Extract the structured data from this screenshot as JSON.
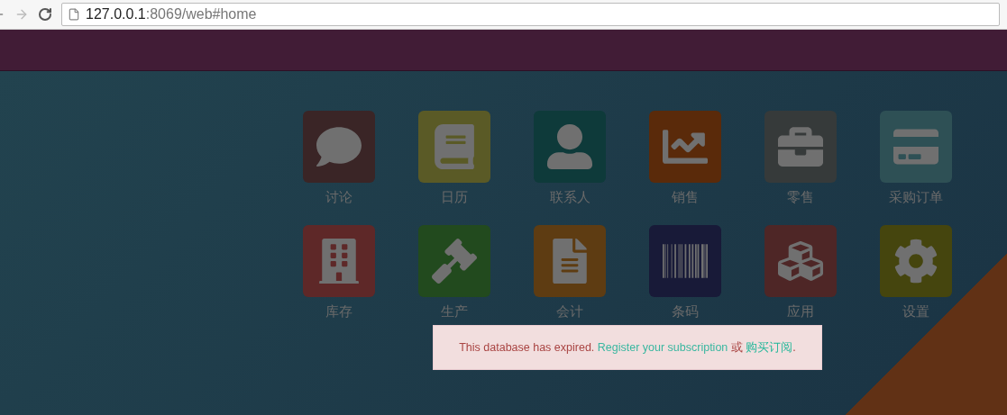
{
  "browser": {
    "url_host": "127.0.0.1",
    "url_path": ":8069/web#home"
  },
  "apps": [
    {
      "label": "讨论",
      "color": "#3a2526"
    },
    {
      "label": "日历",
      "color": "#5a5a26"
    },
    {
      "label": "联系人",
      "color": "#0e3a3a"
    },
    {
      "label": "销售",
      "color": "#5a2a0a"
    },
    {
      "label": "零售",
      "color": "#363a3a"
    },
    {
      "label": "采购订单",
      "color": "#2e5055"
    },
    {
      "label": "库存",
      "color": "#5e2828"
    },
    {
      "label": "生产",
      "color": "#224a1e"
    },
    {
      "label": "会计",
      "color": "#5e3c12"
    },
    {
      "label": "条码",
      "color": "#181a38"
    },
    {
      "label": "应用",
      "color": "#4e2626"
    },
    {
      "label": "设置",
      "color": "#45450e"
    }
  ],
  "alert": {
    "message": "This database has expired.",
    "link_1": "Register your subscription",
    "separator": "或",
    "link_2": "购买订阅",
    "end": "."
  }
}
